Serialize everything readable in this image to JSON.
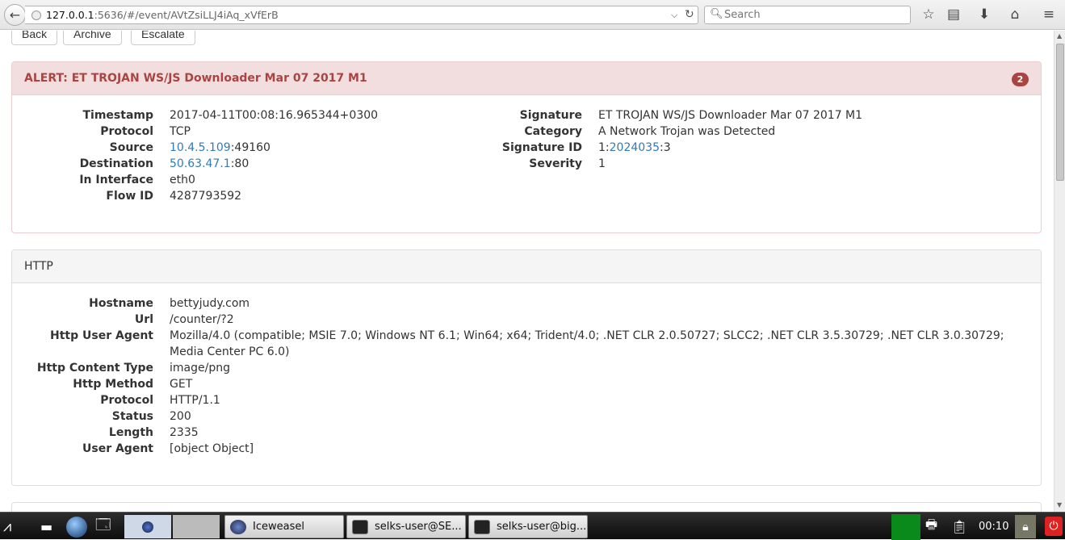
{
  "browser": {
    "url_host": "127.0.0.1",
    "url_rest": ":5636/#/event/AVtZsiLLJ4iAq_xVfErB",
    "search_placeholder": "Search"
  },
  "buttons": {
    "back": "Back",
    "archive": "Archive",
    "escalate": "Escalate"
  },
  "alert": {
    "title": "ALERT: ET TROJAN WS/JS Downloader Mar 07 2017 M1",
    "badge": "2",
    "left": {
      "timestamp_label": "Timestamp",
      "timestamp": "2017-04-11T00:08:16.965344+0300",
      "protocol_label": "Protocol",
      "protocol": "TCP",
      "source_label": "Source",
      "source_ip": "10.4.5.109",
      "source_port": ":49160",
      "destination_label": "Destination",
      "destination_ip": "50.63.47.1",
      "destination_port": ":80",
      "in_interface_label": "In Interface",
      "in_interface": "eth0",
      "flow_id_label": "Flow ID",
      "flow_id": "4287793592"
    },
    "right": {
      "signature_label": "Signature",
      "signature": "ET TROJAN WS/JS Downloader Mar 07 2017 M1",
      "category_label": "Category",
      "category": "A Network Trojan was Detected",
      "signature_id_label": "Signature ID",
      "sid_prefix": "1:",
      "sid": "2024035",
      "sid_suffix": ":3",
      "severity_label": "Severity",
      "severity": "1"
    }
  },
  "http": {
    "title": "HTTP",
    "hostname_label": "Hostname",
    "hostname": "bettyjudy.com",
    "url_label": "Url",
    "url": "/counter/?2",
    "user_agent_label": "Http User Agent",
    "user_agent_line1": "Mozilla/4.0 (compatible; MSIE 7.0; Windows NT 6.1; Win64; x64; Trident/4.0; .NET CLR 2.0.50727; SLCC2; .NET CLR 3.5.30729; .NET CLR 3.0.30729;",
    "user_agent_line2": "Media Center PC 6.0)",
    "content_type_label": "Http Content Type",
    "content_type": "image/png",
    "method_label": "Http Method",
    "method": "GET",
    "protocol_label": "Protocol",
    "protocol": "HTTP/1.1",
    "status_label": "Status",
    "status": "200",
    "length_label": "Length",
    "length": "2335",
    "ua_obj_label": "User Agent",
    "ua_obj": "[object Object]"
  },
  "taskbar": {
    "task1": "Iceweasel",
    "task2": "selks-user@SE...",
    "task3": "selks-user@big...",
    "clock": "00:10"
  }
}
